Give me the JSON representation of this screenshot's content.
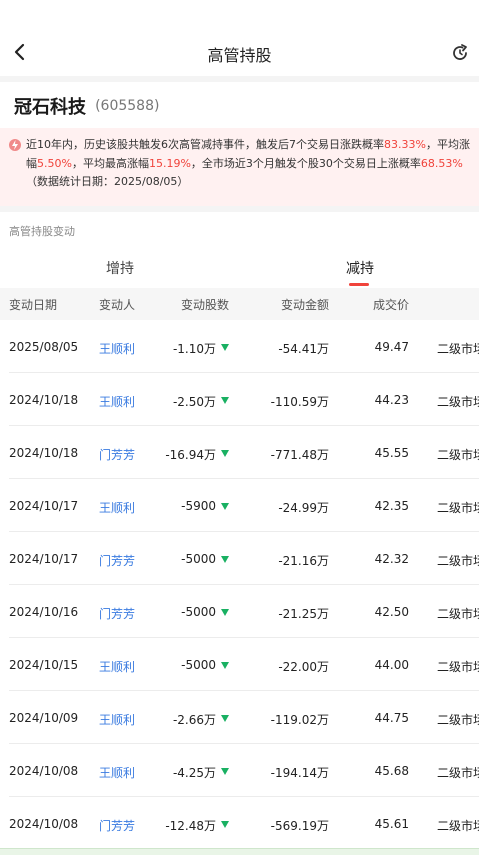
{
  "header": {
    "title": "高管持股",
    "back_icon": "chevron-left-icon",
    "refresh_icon": "refresh-icon"
  },
  "stock": {
    "name": "冠石科技",
    "code": "(605588)"
  },
  "alert": {
    "icon": "info-icon",
    "t1": "近10年内，历史该股共触发6次高管减持事件，触发后7个交易日涨跌概率",
    "v1": "83.33%",
    "t2": "，平均涨幅",
    "v2": "5.50%",
    "t3": "，平均最高涨幅",
    "v3": "15.19%",
    "t4": "，全市场近3个月触发个股30个交易日上涨概率",
    "v4": "68.53%",
    "t5": "（数据统计日期：2025/08/05）",
    "accent_color": "#f0433b"
  },
  "section": {
    "label": "高管持股变动"
  },
  "tabs": [
    {
      "label": "增持",
      "active": false
    },
    {
      "label": "减持",
      "active": true
    }
  ],
  "table": {
    "headers": [
      "变动日期",
      "变动人",
      "变动股数",
      "变动金额",
      "成交价"
    ],
    "rows": [
      {
        "date": "2025/08/05",
        "person": "王顺利",
        "shares": "-1.10万",
        "amount": "-54.41万",
        "price": "49.47",
        "type": "二级市场"
      },
      {
        "date": "2024/10/18",
        "person": "王顺利",
        "shares": "-2.50万",
        "amount": "-110.59万",
        "price": "44.23",
        "type": "二级市场"
      },
      {
        "date": "2024/10/18",
        "person": "门芳芳",
        "shares": "-16.94万",
        "amount": "-771.48万",
        "price": "45.55",
        "type": "二级市场"
      },
      {
        "date": "2024/10/17",
        "person": "王顺利",
        "shares": "-5900",
        "amount": "-24.99万",
        "price": "42.35",
        "type": "二级市场"
      },
      {
        "date": "2024/10/17",
        "person": "门芳芳",
        "shares": "-5000",
        "amount": "-21.16万",
        "price": "42.32",
        "type": "二级市场"
      },
      {
        "date": "2024/10/16",
        "person": "门芳芳",
        "shares": "-5000",
        "amount": "-21.25万",
        "price": "42.50",
        "type": "二级市场"
      },
      {
        "date": "2024/10/15",
        "person": "王顺利",
        "shares": "-5000",
        "amount": "-22.00万",
        "price": "44.00",
        "type": "二级市场"
      },
      {
        "date": "2024/10/09",
        "person": "王顺利",
        "shares": "-2.66万",
        "amount": "-119.02万",
        "price": "44.75",
        "type": "二级市场"
      },
      {
        "date": "2024/10/08",
        "person": "王顺利",
        "shares": "-4.25万",
        "amount": "-194.14万",
        "price": "45.68",
        "type": "二级市场"
      },
      {
        "date": "2024/10/08",
        "person": "门芳芳",
        "shares": "-12.48万",
        "amount": "-569.19万",
        "price": "45.61",
        "type": "二级市场"
      }
    ],
    "down_icon": "down-triangle-icon",
    "down_color": "#19b062",
    "person_link_color": "#3a7be0"
  }
}
